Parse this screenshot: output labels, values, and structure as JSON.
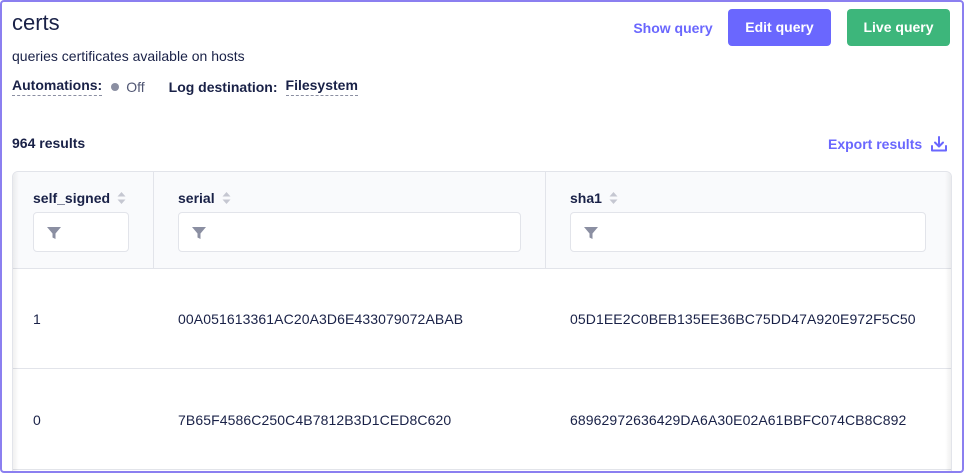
{
  "query": {
    "name": "certs",
    "description": "queries certificates available on hosts"
  },
  "meta": {
    "automations_label": "Automations:",
    "automations_status": "Off",
    "log_destination_label": "Log destination:",
    "log_destination_value": "Filesystem"
  },
  "actions": {
    "show_query": "Show query",
    "edit_query": "Edit query",
    "live_query": "Live query"
  },
  "results": {
    "count_text": "964 results",
    "export_label": "Export results"
  },
  "table": {
    "columns": [
      {
        "label": "self_signed"
      },
      {
        "label": "serial"
      },
      {
        "label": "sha1"
      }
    ],
    "rows": [
      [
        "1",
        "00A051613361AC20A3D6E433079072ABAB",
        "05D1EE2C0BEB135EE36BC75DD47A920E972F5C50"
      ],
      [
        "0",
        "7B65F4586C250C4B7812B3D1CED8C620",
        "68962972636429DA6A30E02A61BBFC074CB8C892"
      ]
    ]
  },
  "colors": {
    "accent": "#6a67fe",
    "live_button": "#3db67b",
    "frame_border": "#8b7ff0",
    "text": "#192147"
  },
  "icons": {
    "sort": "sort-arrows-icon",
    "filter": "filter-funnel-icon",
    "export": "download-icon",
    "status": "status-dot-icon"
  }
}
